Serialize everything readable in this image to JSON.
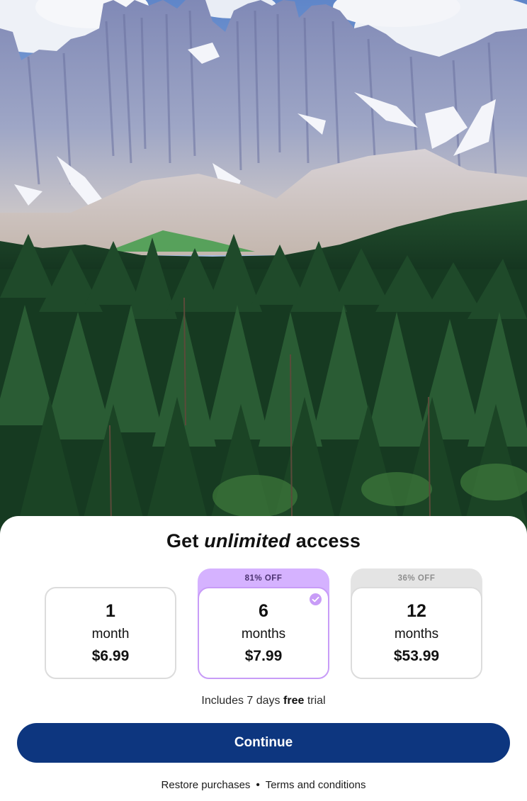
{
  "headline": {
    "prefix": "Get",
    "emphasis": "unlimited",
    "suffix": "access"
  },
  "plans": [
    {
      "quantity": "1",
      "unit": "month",
      "price": "$6.99",
      "badge": "",
      "selected": false
    },
    {
      "quantity": "6",
      "unit": "months",
      "price": "$7.99",
      "badge": "81% OFF",
      "selected": true
    },
    {
      "quantity": "12",
      "unit": "months",
      "price": "$53.99",
      "badge": "36% OFF",
      "selected": false
    }
  ],
  "trial": {
    "before": "Includes 7 days",
    "bold": "free",
    "after": "trial"
  },
  "continue_label": "Continue",
  "footer": {
    "restore_label": "Restore purchases",
    "separator": "•",
    "terms_label": "Terms and conditions"
  },
  "colors": {
    "primary_button": "#0d367f",
    "selected_accent": "#c89cf7",
    "selected_badge": "#d5b2ff",
    "neutral_badge": "#e4e4e4"
  },
  "icons": {
    "selected_check": "checkmark-circle-icon"
  },
  "hero_image": "mountain-forest-landscape"
}
